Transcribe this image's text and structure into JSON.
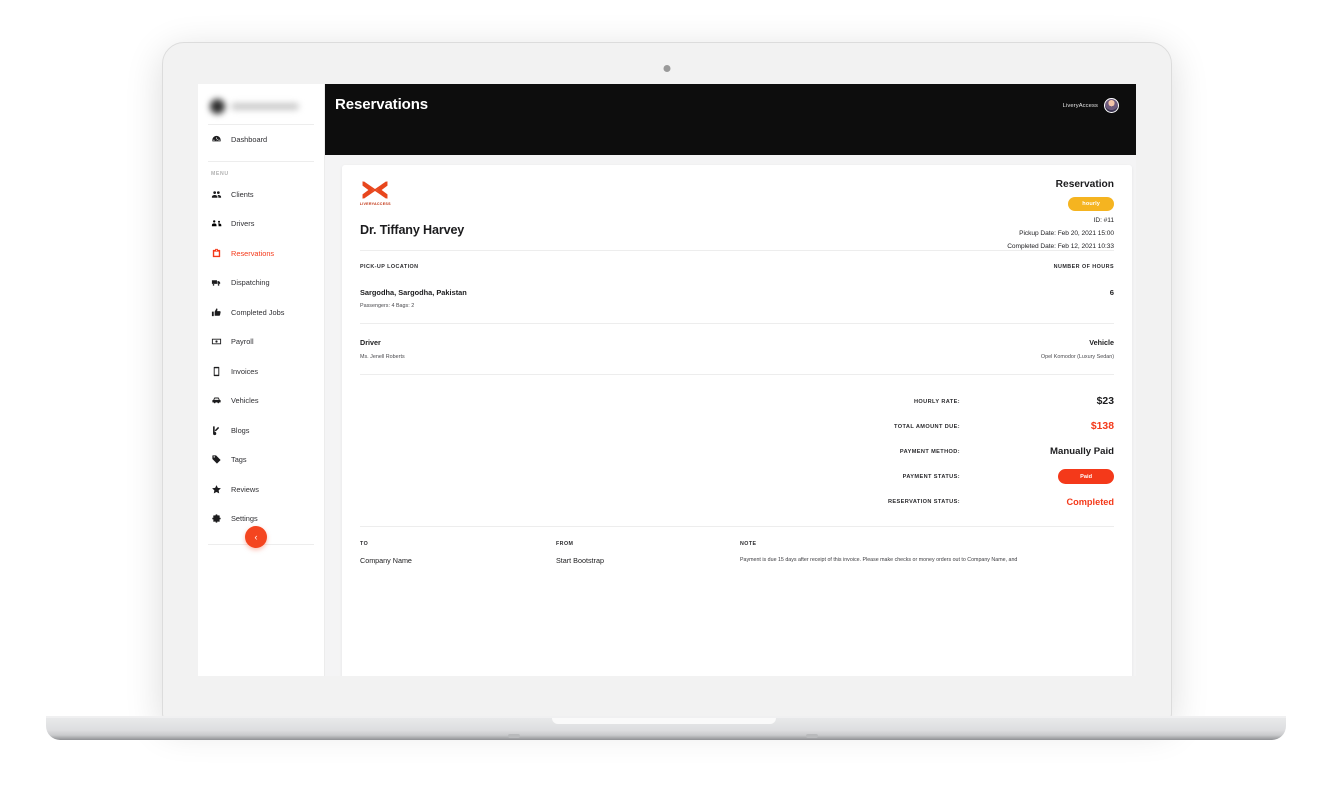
{
  "sidebar": {
    "brand_redacted": true,
    "section_label": "MENU",
    "top_items": [
      {
        "label": "Dashboard",
        "icon": "dashboard-icon",
        "active": false
      }
    ],
    "items": [
      {
        "label": "Clients",
        "icon": "clients-icon",
        "active": false
      },
      {
        "label": "Drivers",
        "icon": "drivers-icon",
        "active": false
      },
      {
        "label": "Reservations",
        "icon": "reservations-icon",
        "active": true
      },
      {
        "label": "Dispatching",
        "icon": "dispatching-icon",
        "active": false
      },
      {
        "label": "Completed Jobs",
        "icon": "thumbs-up-icon",
        "active": false
      },
      {
        "label": "Payroll",
        "icon": "payroll-icon",
        "active": false
      },
      {
        "label": "Invoices",
        "icon": "invoice-icon",
        "active": false
      },
      {
        "label": "Vehicles",
        "icon": "car-icon",
        "active": false
      },
      {
        "label": "Blogs",
        "icon": "blog-icon",
        "active": false
      },
      {
        "label": "Tags",
        "icon": "tag-icon",
        "active": false
      },
      {
        "label": "Reviews",
        "icon": "star-icon",
        "active": false
      },
      {
        "label": "Settings",
        "icon": "gear-icon",
        "active": false
      }
    ],
    "collapse_button": {
      "icon": "chevron-left-icon",
      "glyph": "‹"
    }
  },
  "topbar": {
    "title": "Reservations",
    "account_name": "LiveryAccess",
    "avatar_icon": "user-avatar"
  },
  "invoice": {
    "logo": {
      "icon": "liveryaccess-logo",
      "wordmark": "LIVERYACCESS"
    },
    "client_name": "Dr. Tiffany Harvey",
    "heading": "Reservation",
    "type_badge": "hourly",
    "id_line": "ID: #11",
    "pickup_date_line": "Pickup Date: Feb 20, 2021 15:00",
    "completed_date_line": "Completed Date: Feb 12, 2021 10:33",
    "columns": {
      "pickup_location_label": "PICK-UP LOCATION",
      "number_of_hours_label": "NUMBER OF HOURS"
    },
    "pickup_address": "Sargodha, Sargodha, Pakistan",
    "passengers_bags": "Passengers: 4 Bags: 2",
    "number_of_hours": "6",
    "driver_label": "Driver",
    "driver_name": "Ms. Jenell Roberts",
    "vehicle_label": "Vehicle",
    "vehicle_name": "Opel Komodor (Luxury Sedan)",
    "totals": [
      {
        "label": "HOURLY RATE:",
        "value": "$23",
        "style": "plain"
      },
      {
        "label": "TOTAL AMOUNT DUE:",
        "value": "$138",
        "style": "accent"
      },
      {
        "label": "PAYMENT METHOD:",
        "value": "Manually Paid",
        "style": "method"
      },
      {
        "label": "PAYMENT STATUS:",
        "value": "Paid",
        "style": "pill"
      },
      {
        "label": "RESERVATION STATUS:",
        "value": "Completed",
        "style": "status"
      }
    ],
    "footer": {
      "to_label": "TO",
      "to_value": "Company Name",
      "from_label": "FROM",
      "from_value": "Start Bootstrap",
      "note_label": "NOTE",
      "note_value": "Payment is due 15 days after receipt of this invoice. Please make checks or money orders out to Company Name, and"
    }
  },
  "colors": {
    "accent_orange": "#f4391a",
    "badge_yellow": "#f5b420",
    "topbar_black": "#0d0d0d",
    "app_background": "#f4f4f5"
  }
}
